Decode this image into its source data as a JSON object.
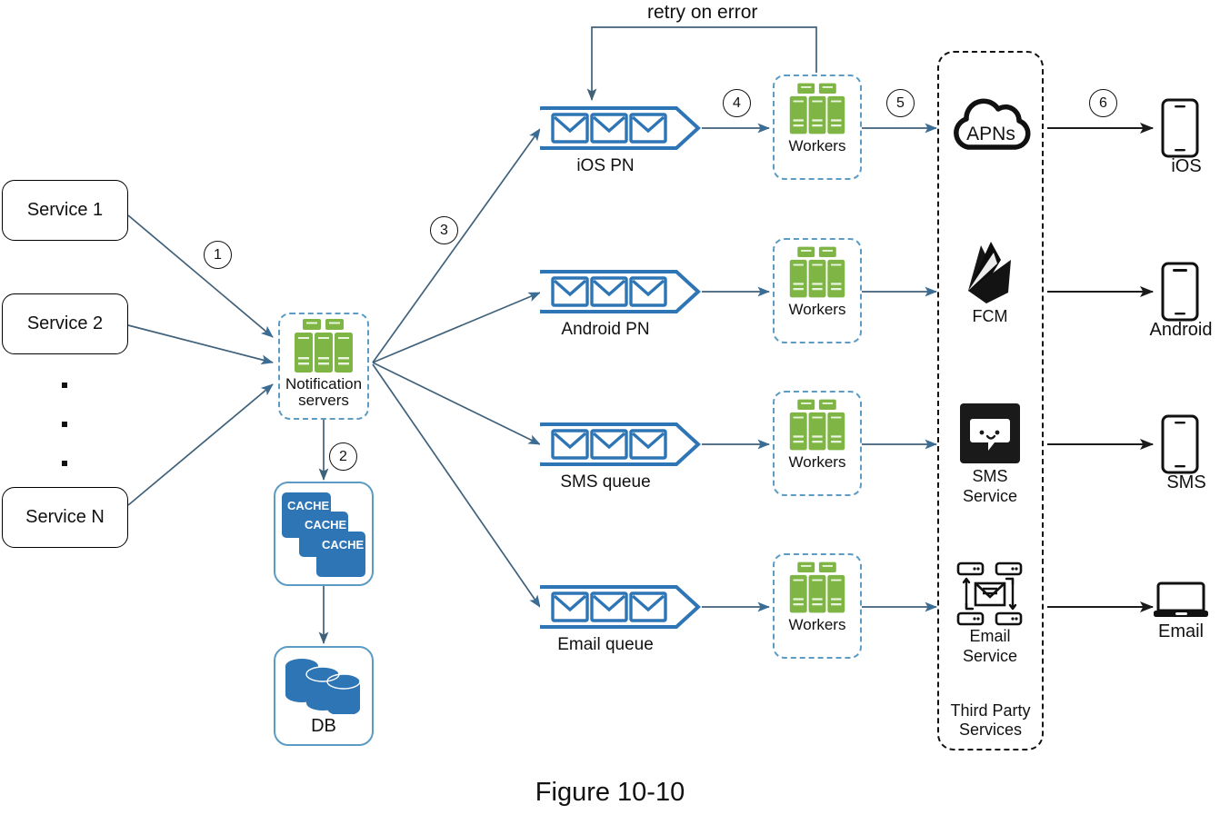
{
  "figure": {
    "caption": "Figure 10-10"
  },
  "annotations": {
    "retry_label": "retry on error"
  },
  "steps": [
    {
      "id": "1",
      "label": "1"
    },
    {
      "id": "2",
      "label": "2"
    },
    {
      "id": "3",
      "label": "3"
    },
    {
      "id": "4",
      "label": "4"
    },
    {
      "id": "5",
      "label": "5"
    },
    {
      "id": "6",
      "label": "6"
    }
  ],
  "services": [
    {
      "label": "Service 1"
    },
    {
      "label": "Service 2"
    },
    {
      "label": "Service N"
    }
  ],
  "notification_servers": {
    "label_line1": "Notification",
    "label_line2": "servers",
    "icon": "green-server-rack-icon"
  },
  "storage": {
    "cache": {
      "tiles": [
        "CACHE",
        "CACHE",
        "CACHE"
      ],
      "icon": "cache-stack-icon"
    },
    "db": {
      "label": "DB",
      "icon": "database-cylinders-icon"
    }
  },
  "queues": [
    {
      "label": "iOS PN",
      "icon": "envelope-icon"
    },
    {
      "label": "Android PN",
      "icon": "envelope-icon"
    },
    {
      "label": "SMS queue",
      "icon": "envelope-icon"
    },
    {
      "label": "Email queue",
      "icon": "envelope-icon"
    }
  ],
  "workers": [
    {
      "label": "Workers",
      "icon": "green-server-rack-icon"
    },
    {
      "label": "Workers",
      "icon": "green-server-rack-icon"
    },
    {
      "label": "Workers",
      "icon": "green-server-rack-icon"
    },
    {
      "label": "Workers",
      "icon": "green-server-rack-icon"
    }
  ],
  "third_party": {
    "container_label_line1": "Third Party",
    "container_label_line2": "Services",
    "items": [
      {
        "label": "APNs",
        "label_line2": "",
        "icon": "apns-cloud-icon"
      },
      {
        "label": "FCM",
        "label_line2": "",
        "icon": "firebase-fcm-icon"
      },
      {
        "label": "SMS",
        "label_line2": "Service",
        "icon": "sms-chat-icon"
      },
      {
        "label": "Email",
        "label_line2": "Service",
        "icon": "email-service-icon"
      }
    ]
  },
  "devices": [
    {
      "label": "iOS",
      "icon": "smartphone-icon"
    },
    {
      "label": "Android",
      "icon": "smartphone-icon"
    },
    {
      "label": "SMS",
      "icon": "smartphone-icon"
    },
    {
      "label": "Email",
      "icon": "laptop-icon"
    }
  ],
  "colors": {
    "green": "#7EB544",
    "green_dark": "#6FA33A",
    "blue": "#2E75B6",
    "blue_light": "#5b9bc4",
    "arrow": "#3b5a72",
    "black": "#111111"
  }
}
